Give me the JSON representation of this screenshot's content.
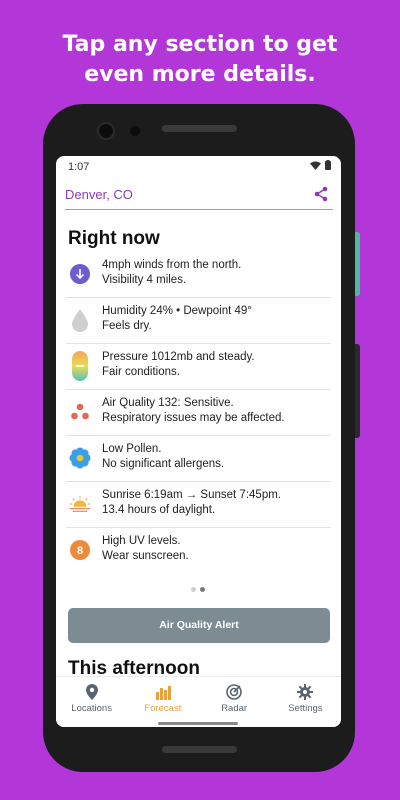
{
  "promo": {
    "line1": "Tap any section to get",
    "line2": "even more details."
  },
  "status": {
    "time": "1:07"
  },
  "header": {
    "location": "Denver, CO",
    "share_icon": "share-icon"
  },
  "right_now": {
    "title": "Right now",
    "rows": [
      {
        "icon": "wind-arrow-icon",
        "line1": "4mph winds from the north.",
        "line2": "Visibility 4 miles."
      },
      {
        "icon": "humidity-drop-icon",
        "line1": "Humidity 24% • Dewpoint 49°",
        "line2": "Feels dry."
      },
      {
        "icon": "pressure-gauge-icon",
        "line1": "Pressure 1012mb and steady.",
        "line2": "Fair conditions."
      },
      {
        "icon": "air-quality-icon",
        "line1": "Air Quality 132: Sensitive.",
        "line2": "Respiratory issues may be affected."
      },
      {
        "icon": "pollen-flower-icon",
        "line1": "Low Pollen.",
        "line2": "No significant allergens."
      },
      {
        "icon": "sunrise-icon",
        "line1": "Sunrise 6:19am → Sunset 7:45pm.",
        "line2": "13.4 hours of daylight."
      },
      {
        "icon": "uv-index-icon",
        "badge": "8",
        "line1": "High UV levels.",
        "line2": "Wear sunscreen."
      }
    ]
  },
  "pager": {
    "count": 2,
    "active": 1
  },
  "alert_button": {
    "label": "Air Quality Alert"
  },
  "afternoon": {
    "title": "This afternoon"
  },
  "nav": {
    "items": [
      {
        "label": "Locations",
        "icon": "location-pin-icon"
      },
      {
        "label": "Forecast",
        "icon": "bar-chart-icon",
        "active": true
      },
      {
        "label": "Radar",
        "icon": "radar-icon"
      },
      {
        "label": "Settings",
        "icon": "gear-icon"
      }
    ]
  },
  "colors": {
    "background": "#b337d8",
    "accent": "#8b3bb8",
    "active_nav": "#e8a23c",
    "alert_button": "#7d8c93"
  }
}
